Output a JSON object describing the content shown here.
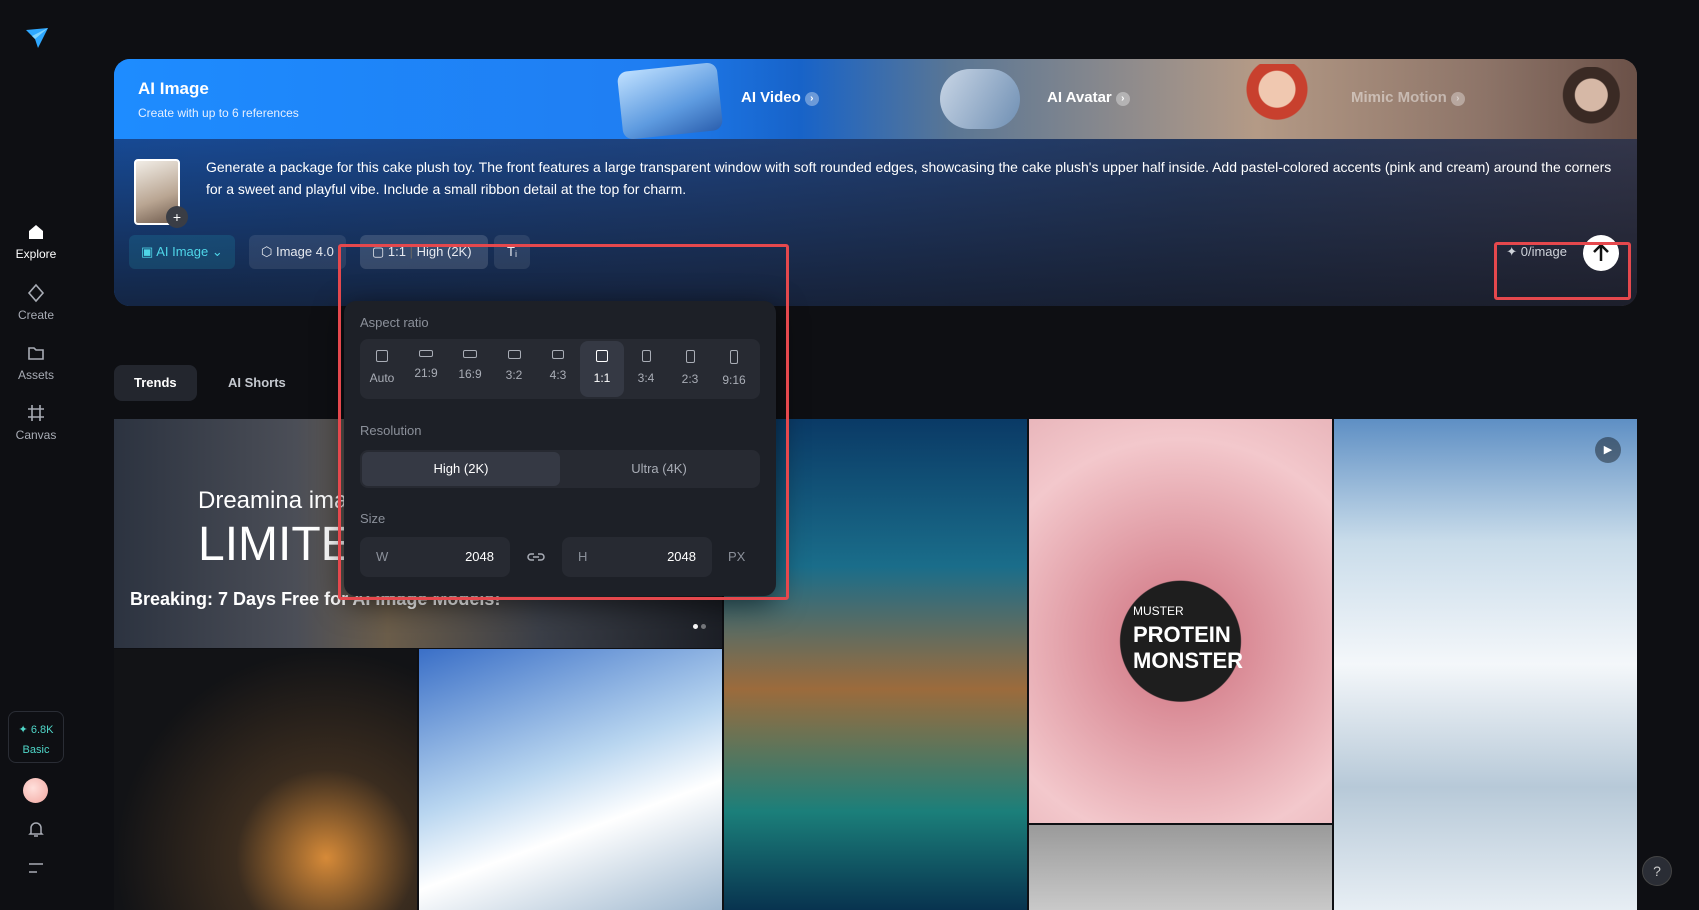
{
  "sidebar": {
    "items": [
      {
        "label": "Explore",
        "icon": "home-icon",
        "active": true
      },
      {
        "label": "Create",
        "icon": "sparkle-icon"
      },
      {
        "label": "Assets",
        "icon": "folder-icon"
      },
      {
        "label": "Canvas",
        "icon": "canvas-icon"
      }
    ],
    "credits": "✦ 6.8K",
    "plan": "Basic"
  },
  "panel": {
    "title": "AI Image",
    "subtitle": "Create with up to 6 references",
    "tabs": [
      {
        "label": "AI Video"
      },
      {
        "label": "AI Avatar"
      },
      {
        "label": "Mimic Motion"
      }
    ],
    "prompt": "Generate a package for this cake plush toy. The front features a large transparent window with soft rounded edges, showcasing the cake plush's upper half inside. Add pastel-colored accents (pink and cream) around the corners for a sweet and playful vibe. Include a small ribbon detail at the top for charm.",
    "controls": {
      "model": "AI Image",
      "version": "Image 4.0",
      "ratio": "1:1",
      "quality": "High (2K)"
    },
    "cost": "✦ 0/image"
  },
  "popover": {
    "aspect_label": "Aspect ratio",
    "ratios": [
      "Auto",
      "21:9",
      "16:9",
      "3:2",
      "4:3",
      "1:1",
      "3:4",
      "2:3",
      "9:16"
    ],
    "selected_ratio": "1:1",
    "resolution_label": "Resolution",
    "resolutions": [
      "High (2K)",
      "Ultra (4K)"
    ],
    "selected_resolution": "High (2K)",
    "size_label": "Size",
    "width_key": "W",
    "width": "2048",
    "height_key": "H",
    "height": "2048",
    "unit": "PX"
  },
  "feed": {
    "tabs": [
      "Trends",
      "AI Shorts"
    ],
    "banner_overlay_1": "Dreamina imag",
    "banner_overlay_2": "LIMITED",
    "banner_title": "Breaking: 7 Days Free for AI Image Models!",
    "card_text_1": "MUSTER",
    "card_text_2": "PROTEIN",
    "card_text_3": "MONSTER"
  },
  "colors": {
    "accent": "#4fd6c8",
    "highlight": "#e5484d",
    "bg": "#0e0f13"
  }
}
